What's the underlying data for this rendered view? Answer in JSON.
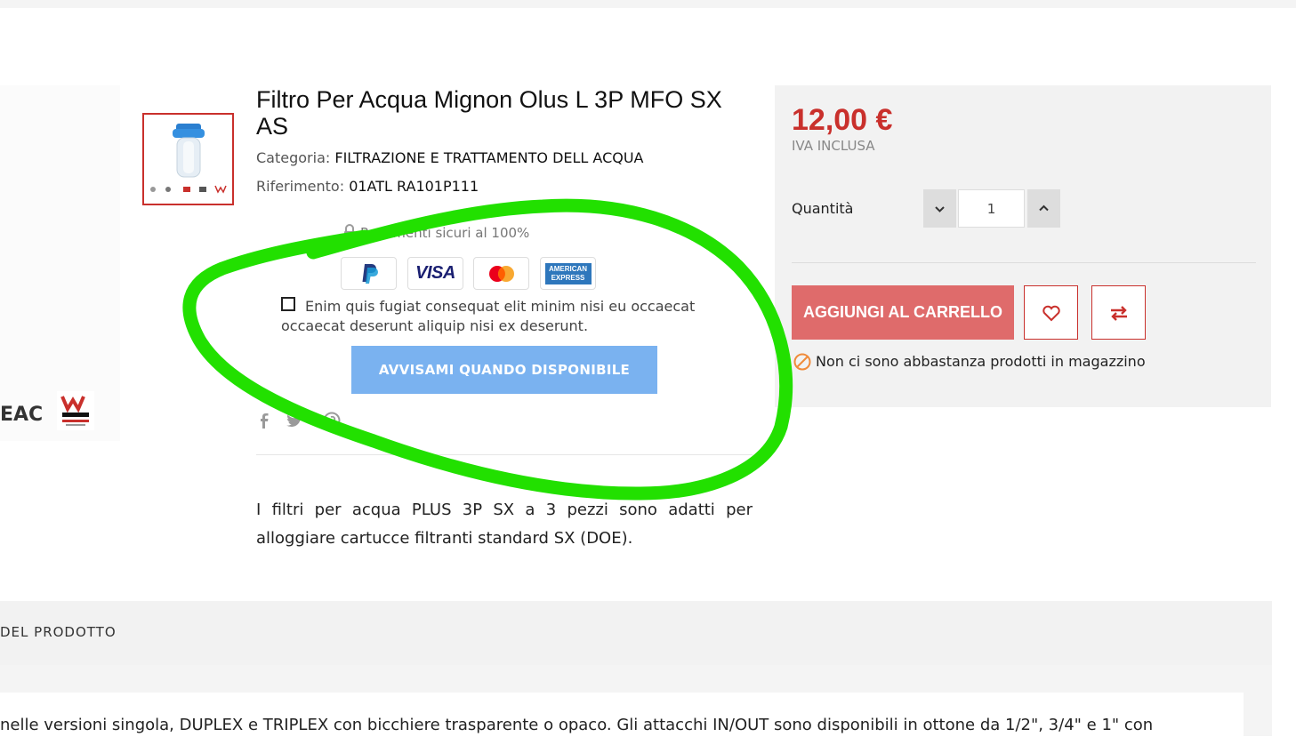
{
  "product": {
    "title": "Filtro Per Acqua Mignon Olus L 3P MFO SX AS",
    "category_label": "Categoria:",
    "category_value": "FILTRAZIONE E TRATTAMENTO DELL ACQUA",
    "reference_label": "Riferimento:",
    "reference_value": "01ATL RA101P111",
    "secure_payments": "Pagamenti sicuri al 100%",
    "payment_methods": [
      "PayPal",
      "VISA",
      "Mastercard",
      "American Express"
    ],
    "amex_text": "AMERICAN EXPRESS",
    "visa_text": "VISA",
    "gdpr_text": "Enim quis fugiat consequat elit minim nisi eu occaecat occaecat deserunt aliquip nisi ex deserunt.",
    "notify_button": "AVVISAMI QUANDO DISPONIBILE",
    "social": [
      "facebook-icon",
      "twitter-icon",
      "pinterest-icon"
    ],
    "short_description": "I filtri per acqua PLUS 3P SX a 3 pezzi sono adatti per alloggiare cartucce filtranti standard SX (DOE).",
    "partial_marking": "EAC"
  },
  "buy_box": {
    "price": "12,00 €",
    "tax": "IVA INCLUSA",
    "quantity_label": "Quantità",
    "quantity_value": "1",
    "add_to_cart": "AGGIUNGI AL CARRELLO",
    "stock_message": "Non ci sono abbastanza prodotti in magazzino"
  },
  "tabs": {
    "label": "DEL PRODOTTO",
    "description": "nelle versioni singola, DUPLEX e TRIPLEX con bicchiere trasparente o opaco. Gli attacchi IN/OUT sono disponibili in ottone da 1/2\", 3/4\" e 1\" con"
  },
  "colors": {
    "accent": "#c9302c",
    "add_to_cart_bg": "#df6b6b",
    "notify_bg": "#7ab2f0",
    "annotation": "#22e000"
  }
}
